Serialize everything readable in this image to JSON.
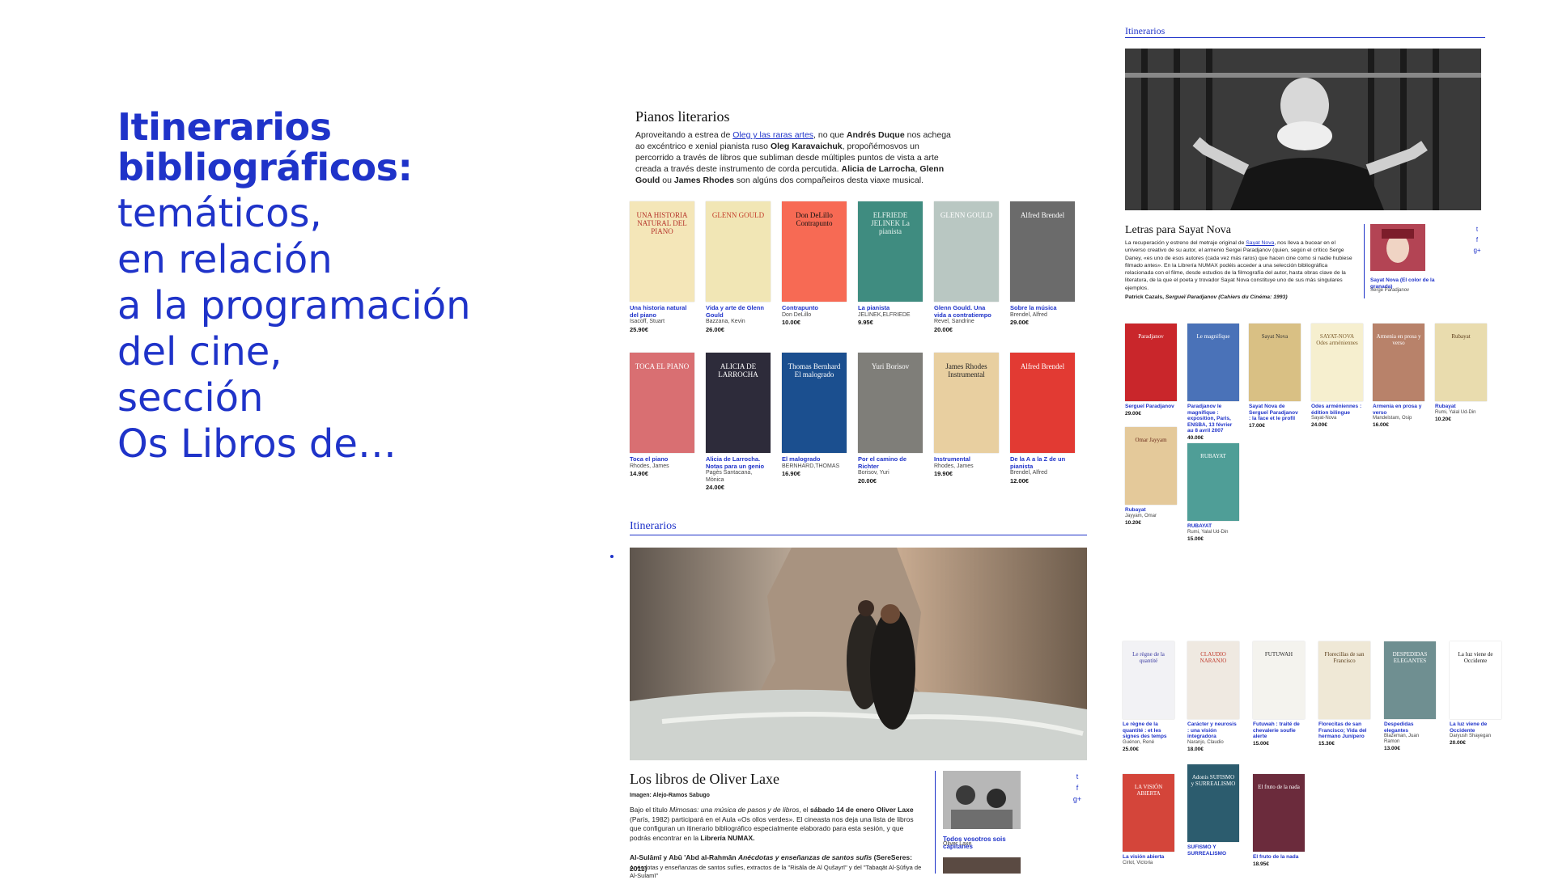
{
  "headline": {
    "bold": [
      "Itinerarios",
      "bibliográficos:"
    ],
    "light": [
      "temáticos,",
      "en relación",
      "a la programación",
      "del cine,",
      "sección",
      "Os Libros de…"
    ]
  },
  "pianos": {
    "title": "Pianos literarios",
    "p1": "Aproveitando a estrea de ",
    "link": "Oleg y las raras artes",
    "p2": ", no que ",
    "b1": "Andrés Duque",
    "p3": " nos achega ao excéntrico e xenial pianista ruso ",
    "b2": "Oleg Karavaichuk",
    "p4": ", propoñémosvos un percorrido a través de libros que subliman desde múltiples puntos de vista a arte creada a través deste instrumento de corda percutida. ",
    "b3": "Alicia de Larrocha",
    "p5": ", ",
    "b4": "Glenn Gould",
    "p6": " ou ",
    "b5": "James Rhodes",
    "p7": " son algúns dos compañeiros desta viaxe musical.",
    "books": [
      {
        "title": "Una historia natural del piano",
        "author": "Isacoff, Stuart",
        "price": "25.90€",
        "cover": "#f4e6b8",
        "ctext": "UNA HISTORIA NATURAL DEL PIANO",
        "ccolor": "#b5332a"
      },
      {
        "title": "Vida y arte de Glenn Gould",
        "author": "Bazzana, Kevin",
        "price": "26.00€",
        "cover": "#f1e6b5",
        "ctext": "GLENN GOULD",
        "ccolor": "#c43d2a"
      },
      {
        "title": "Contrapunto",
        "author": "Don DeLillo",
        "price": "10.00€",
        "cover": "#f76a54",
        "ctext": "Don DeLillo Contrapunto",
        "ccolor": "#111"
      },
      {
        "title": "La pianista",
        "author": "JELINEK,ELFRIEDE",
        "price": "9.95€",
        "cover": "#3f8c80",
        "ctext": "ELFRIEDE JELINEK La pianista",
        "ccolor": "#e8f4f0"
      },
      {
        "title": "Glenn Gould. Una vida a contratiempo",
        "author": "Revel, Sandrine",
        "price": "20.00€",
        "cover": "#b9c7c2",
        "ctext": "GLENN GOULD",
        "ccolor": "#ffffff"
      },
      {
        "title": "Sobre la música",
        "author": "Brendel, Alfred",
        "price": "29.00€",
        "cover": "#6b6b6b",
        "ctext": "Alfred Brendel",
        "ccolor": "#ffffff"
      },
      {
        "title": "Toca el piano",
        "author": "Rhodes, James",
        "price": "14.90€",
        "cover": "#d96f72",
        "ctext": "TOCA EL PIANO",
        "ccolor": "#ffffff"
      },
      {
        "title": "Alicia de Larrocha. Notas para un genio",
        "author": "Pagès Santacana, Mònica",
        "price": "24.00€",
        "cover": "#2d2b3a",
        "ctext": "ALICIA DE LARROCHA",
        "ccolor": "#ffffff"
      },
      {
        "title": "El malogrado",
        "author": "BERNHARD,THOMAS",
        "price": "16.90€",
        "cover": "#1b4f8f",
        "ctext": "Thomas Bernhard El malogrado",
        "ccolor": "#ffffff"
      },
      {
        "title": "Por el camino de Richter",
        "author": "Borisov, Yuri",
        "price": "20.00€",
        "cover": "#7f7e79",
        "ctext": "Yuri Borisov",
        "ccolor": "#ffffff"
      },
      {
        "title": "Instrumental",
        "author": "Rhodes, James",
        "price": "19.90€",
        "cover": "#e8cfa0",
        "ctext": "James Rhodes Instrumental",
        "ccolor": "#222"
      },
      {
        "title": "De la A a la Z de un pianista",
        "author": "Brendel, Alfred",
        "price": "12.00€",
        "cover": "#e23a33",
        "ctext": "Alfred Brendel",
        "ccolor": "#ffffff"
      }
    ]
  },
  "itinerarios_label": "Itinerarios",
  "oliver": {
    "title": "Los libros de Oliver Laxe",
    "credit": "Imagen: Alejo-Ramos Sabugo",
    "p1": "Bajo el título ",
    "i1": "Mimosas: una música de pasos y de libros",
    "p2": ", el ",
    "b1": "sábado 14 de enero Oliver Laxe",
    "p3": " (París, 1982) participará en el Aula «Os ollos verdes». El cineasta nos deja una lista de libros que configuran un itinerario bibliográfico especialmente elaborado para esta sesión, y que podrás encontrar en la ",
    "b2": "Librería NUMAX.",
    "sub": "Al-Sulāmī y Abū 'Abd al-Rahmān ",
    "sub_i": "Anécdotas y enseñanzas de santos sufis",
    "sub2": " (SereSeres: 2011)",
    "p5": "Anécdotas y enseñanzas de santos sufíes, extractos de la \"Risāla de Al Qušayrī\" y del \"Tabaqāt Al-Şūfiya de Al-Sulamī\"",
    "side_title": "Todos vosotros sois capitanes",
    "side_author": "Oliver Laxe",
    "books": [
      {
        "title": "Le règne de la quantité : et les signes des temps",
        "author": "Guénon, René",
        "price": "25.00€",
        "cover": "#f2f2f5",
        "ccolor": "#3a3aa0",
        "ctext": "Le règne de la quantité"
      },
      {
        "title": "Carácter y neurosis : una visión integradora",
        "author": "Naranjo, Claudio",
        "price": "18.00€",
        "cover": "#efe9e1",
        "ccolor": "#c0392b",
        "ctext": "CLAUDIO NARANJO"
      },
      {
        "title": "Futuwah : traité de chevalerie soufie alerte",
        "author": "",
        "price": "15.00€",
        "cover": "#f4f3ee",
        "ccolor": "#2c2c2c",
        "ctext": "FUTUWAH"
      },
      {
        "title": "Florecitas de san Francisco; Vida del hermano Junípero",
        "author": "",
        "price": "15.30€",
        "cover": "#efe8d6",
        "ccolor": "#5a3e1b",
        "ctext": "Florecillas de san Francisco"
      },
      {
        "title": "Despedidas elegantes",
        "author": "Blazeman, Juan Ramon",
        "price": "13.00€",
        "cover": "#6f8f91",
        "ccolor": "#ffffff",
        "ctext": "DESPEDIDAS ELEGANTES"
      },
      {
        "title": "La luz viene de Occidente",
        "author": "Daryush Shayegan",
        "price": "20.00€",
        "cover": "#ffffff",
        "ccolor": "#111",
        "ctext": "La luz viene de Occidente"
      },
      {
        "title": "La visión abierta",
        "author": "Cirlot, Victoria",
        "price": "",
        "cover": "#d4453a",
        "ccolor": "#ffffff",
        "ctext": "LA VISIÓN ABIERTA"
      },
      {
        "title": "SUFISMO Y SURREALISMO",
        "author": "",
        "price": "",
        "cover": "#2c5c6e",
        "ccolor": "#ffffff",
        "ctext": "Adonis SUFISMO y SURREALISMO"
      },
      {
        "title": "El fruto de la nada",
        "author": "",
        "price": "18.95€",
        "cover": "#6b2b3c",
        "ccolor": "#ffffff",
        "ctext": "El fruto de la nada"
      }
    ]
  },
  "sayat": {
    "title": "Letras para Sayat Nova",
    "p1": "La recuperación y estreno del metraje original de ",
    "link": "Sayat Nova",
    "p2": ", nos lleva a bucear en el universo creativo de su autor, el armenio Sergei Paradjanov (quien, según el crítico Serge Daney, «es uno de esos autores (cada vez más raros) que hacen cine como si nadie hubiese filmado antes». En la Librería NUMAX podéis acceder a una selección bibliográfica relacionada con el filme, desde estudios de la filmografía del autor, hasta obras clave de la literatura, de la que el poeta y trovador Sayat Nova constituye uno de sus más singulares ejemplos.",
    "quote": "Patrick Cazals, ",
    "quote_i": "Sergueï Paradjanov (Cahiers du Cinéma: 1993)",
    "side_title": "Sayat Nova (El color de la granada)",
    "side_author": "Serge Paradjanov",
    "books": [
      {
        "title": "Sergueï Paradjanov",
        "author": "",
        "price": "29.00€",
        "cover": "#c9262b",
        "ccolor": "#ffffff",
        "ctext": "Paradjanov"
      },
      {
        "title": "Paradjanov le magnifique : exposition, Paris, ENSBA, 13 février au 8 avril 2007",
        "author": "",
        "price": "40.00€",
        "cover": "#4a72b8",
        "ccolor": "#ffffff",
        "ctext": "Le magnifique"
      },
      {
        "title": "Sayat Nova de Sergueï Paradjanov : la face et le profil",
        "author": "",
        "price": "17.00€",
        "cover": "#d9c084",
        "ccolor": "#333",
        "ctext": "Sayat Nova"
      },
      {
        "title": "Odes arméniennes : édition bilingue",
        "author": "Sayat-Nova",
        "price": "24.00€",
        "cover": "#f6efcf",
        "ccolor": "#7a5a2a",
        "ctext": "SAYAT-NOVA Odes arméniennes"
      },
      {
        "title": "Armenia en prosa y verso",
        "author": "Mandelstam, Osip",
        "price": "16.00€",
        "cover": "#b8826a",
        "ccolor": "#ffffff",
        "ctext": "Armenia en prosa y verso"
      },
      {
        "title": "Rubayat",
        "author": "Rumi, Yalal Ud-Din",
        "price": "10.20€",
        "cover": "#e9dcae",
        "ccolor": "#5a3a1a",
        "ctext": "Rubayat"
      },
      {
        "title": "Rubayat",
        "author": "Jayyam, Omar",
        "price": "10.20€",
        "cover": "#e4c99a",
        "ccolor": "#6a2a1a",
        "ctext": "Omar Jayyam"
      },
      {
        "title": "RUBAYAT",
        "author": "Rumi, Yalal Ud-Din",
        "price": "15.00€",
        "cover": "#4f9e97",
        "ccolor": "#ffffff",
        "ctext": "RUBAYAT"
      }
    ]
  },
  "social": [
    "t",
    "f",
    "g+"
  ]
}
